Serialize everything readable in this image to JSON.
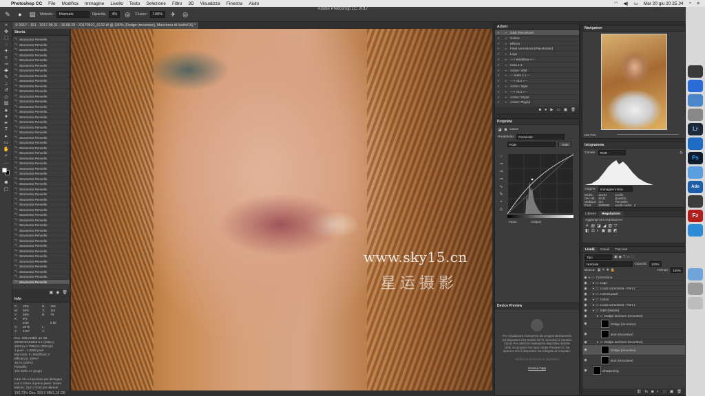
{
  "menubar": {
    "app": "Photoshop CC",
    "items": [
      "File",
      "Modifica",
      "Immagine",
      "Livello",
      "Testo",
      "Selezione",
      "Filtro",
      "3D",
      "Visualizza",
      "Finestra",
      "Aiuto"
    ],
    "clock": "Mar 20 giu  20 25 34"
  },
  "window_title": "Adobe Photoshop CC 2017",
  "options": {
    "metodo_label": "Metodo:",
    "metodo_value": "Normale",
    "opacita_label": "Opacità:",
    "opacita_value": "4%",
    "flusso_label": "Flusso:",
    "flusso_value": "100%"
  },
  "document_tab": "© 2017 - 151 - 2017.05.31 - 15.08.20 - 20170531_0122.tif @ 180% (Dodge (recursive), Maschera di livello/16) *",
  "history": {
    "title": "Storia",
    "item_label": "Strumento Pennello",
    "items": [
      "Strumento Pennello",
      "Strumento Pennello",
      "Strumento Pennello",
      "Strumento Pennello",
      "Strumento Pennello",
      "Strumento Pennello",
      "Strumento Pennello",
      "Strumento Pennello",
      "Strumento Pennello",
      "Strumento Pennello",
      "Strumento Pennello",
      "Strumento Pennello",
      "Strumento Pennello",
      "Strumento Pennello",
      "Strumento Pennello",
      "Strumento Pennello",
      "Strumento Pennello",
      "Strumento Pennello",
      "Strumento Pennello",
      "Strumento Pennello",
      "Strumento Pennello",
      "Strumento Pennello",
      "Strumento Pennello",
      "Strumento Pennello",
      "Strumento Pennello",
      "Strumento Pennello",
      "Strumento Pennello",
      "Strumento Pennello",
      "Strumento Pennello",
      "Strumento Pennello",
      "Strumento Pennello",
      "Strumento Pennello",
      "Strumento Pennello",
      "Strumento Pennello",
      "Strumento Pennello",
      "Strumento Pennello",
      "Strumento Pennello",
      "Strumento Pennello",
      "Strumento Pennello",
      "Strumento Pennello",
      "Strumento Pennello",
      "Strumento Pennello",
      "Strumento Pennello",
      "Strumento Pennello",
      "Strumento Pennello",
      "Strumento Pennello",
      "Strumento Pennello",
      "Strumento Pennello"
    ],
    "active_index": 47
  },
  "info": {
    "title": "Info",
    "c_label": "C:",
    "c_value": "29%",
    "m_label": "M:",
    "m_value": "56%",
    "y_label": "Y:",
    "y_value": "59%",
    "k_label": "K:",
    "k_value": "6%",
    "r_label": "R:",
    "r_value": "158",
    "g_label": "G:",
    "g_value": "110",
    "b_label": "B:",
    "b_value": "79",
    "bit_left": "8 bit",
    "bit_right": "8 bit",
    "x_label": "X:",
    "x_value": "2875",
    "yy_label": "Y:",
    "yy_value": "2157",
    "l_label": "L:",
    "l_value": "",
    "a_label": "A:",
    "a_value": "",
    "docs": "Doc: 209,9 MB/1,18 GB\nsRGB IEC61966-2.1 (16bpc)\n4848 px x 7966 px (300 ppi)\n1 pixel = 1,0000 pixel\nMancanti: 0 | Modificati: 0\nEfficienza: 100%*\n19,7s (100%)\nPennello\n153 livelli, 47 gruppi\n\nFare clic e trascinare per dipingere con il colore di primo piano. Usare Maiusc, Opz e Cmd per ulteriori opzioni."
  },
  "statusbar": "180,73%        Doc: 209,9 MB/1,18 GB",
  "watermark": {
    "line1": "www.sky15.cn",
    "line2": "星运摄影"
  },
  "actions": {
    "title": "Azioni",
    "items": [
      "D&B (Recursive)",
      "Colora",
      "Effects",
      "Final corrections (Placeholder)",
      "Logo",
      "---> Workflow <---",
      "Insta 2.1",
      "Action: Wild",
      "--- Insta 2.1 ---",
      "---> v3.2 <---",
      "Action: Style",
      "---> v3.3 <---",
      "Action: Dryad",
      "Action: Playful"
    ]
  },
  "properties": {
    "title": "Proprietà",
    "type": "Curve",
    "preset_label": "Predefinito:",
    "preset_value": "Personale",
    "channel_value": "RGB",
    "auto_label": "Auto",
    "input_label": "Input:",
    "output_label": "Output:"
  },
  "device_preview": {
    "title": "Device Preview",
    "body": "Per visualizzare l'anteprima dei progetti direttamente sul dispositivo iOS tramite Wi-Fi, accedete a Creative Cloud. Per utilizzare l'anteprima dispositivo tramite USB, accertatevi che l'app Adobe Preview CC sia aperta e che il dispositivo sia collegato al computer.",
    "link1": "Verifica la presenza di dispositivi",
    "link2": "Scarica l'app"
  },
  "navigator": {
    "title": "Navigatore",
    "zoom": "180,73%"
  },
  "histogram": {
    "title": "Istogramma",
    "channel_label": "Canale:",
    "channel_value": "RGB",
    "source_label": "Origine:",
    "source_value": "Immagine intera",
    "media_label": "Media:",
    "media_value": "119,81",
    "dev_label": "Dev std:",
    "dev_value": "48,31",
    "mediana_label": "Mediana:",
    "mediana_value": "114",
    "pixel_label": "Pixel:",
    "pixel_value": "3858880",
    "livello_label": "Livello:",
    "quantita_label": "Quantità:",
    "percentile_label": "Percentile:",
    "cache_label": "Livello cache:",
    "cache_value": "4"
  },
  "adjust": {
    "tab1": "Librerie",
    "tab2": "Regolazioni",
    "caption": "Aggiungi una regolazione"
  },
  "layers": {
    "tabs": [
      "Livelli",
      "Canali",
      "Tracciati"
    ],
    "filter_value": "Tipo",
    "blend_value": "Normale",
    "opacity_label": "Opacità:",
    "opacity_value": "100%",
    "lock_label": "Blocca:",
    "fill_label": "Riempi:",
    "fill_value": "100%",
    "items": [
      {
        "name": "Correctiona",
        "type": "group",
        "depth": 0
      },
      {
        "name": "Logo",
        "type": "group",
        "depth": 1
      },
      {
        "name": "Local corrections - Part 2",
        "type": "group",
        "depth": 1
      },
      {
        "name": "Actions pack",
        "type": "group",
        "depth": 1
      },
      {
        "name": "Action",
        "type": "group",
        "depth": 1
      },
      {
        "name": "Local corrections - Part 1",
        "type": "group",
        "depth": 1
      },
      {
        "name": "D&B (Master)",
        "type": "group",
        "depth": 1
      },
      {
        "name": "Dodge and burn (recursive)",
        "type": "group",
        "depth": 2
      },
      {
        "name": "Dodge (recursive)",
        "type": "layer",
        "depth": 3
      },
      {
        "name": "Burn (recursive)",
        "type": "layer",
        "depth": 3
      },
      {
        "name": "Dodge and burn (recursive)",
        "type": "group",
        "depth": 2
      },
      {
        "name": "Dodge (recursive)",
        "type": "layer",
        "depth": 3,
        "selected": true
      },
      {
        "name": "Burn (recursive)",
        "type": "layer",
        "depth": 3
      },
      {
        "name": "Sharpening",
        "type": "layer",
        "depth": 1
      }
    ]
  },
  "dock": [
    "Lr",
    "Ps",
    "Ado",
    "Fz"
  ]
}
